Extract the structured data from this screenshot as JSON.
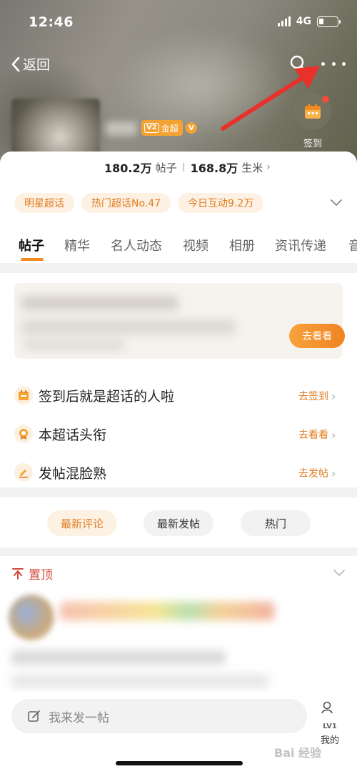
{
  "status_bar": {
    "time": "12:46",
    "network": "4G"
  },
  "nav": {
    "back_label": "返回"
  },
  "profile": {
    "badge_label": "金超",
    "badge_level": "V2",
    "v_mark": "V"
  },
  "checkin": {
    "label": "签到"
  },
  "stats": {
    "posts_count": "180.2万",
    "posts_label": "帖子",
    "fans_count": "168.8万",
    "fans_label": "生米"
  },
  "tags": [
    "明星超话",
    "热门超话No.47",
    "今日互动9.2万"
  ],
  "tabs": [
    "帖子",
    "精华",
    "名人动态",
    "视频",
    "相册",
    "资讯传递",
    "音"
  ],
  "banner": {
    "button": "去看看"
  },
  "tasks": [
    {
      "label": "签到后就是超话的人啦",
      "action": "去签到"
    },
    {
      "label": "本超话头衔",
      "action": "去看看"
    },
    {
      "label": "发帖混脸熟",
      "action": "去发帖"
    }
  ],
  "sort_options": [
    "最新评论",
    "最新发帖",
    "热门"
  ],
  "pinned": {
    "label": "置顶"
  },
  "compose": {
    "placeholder": "我来发一帖"
  },
  "mine": {
    "level": "LV1",
    "label": "我的"
  },
  "watermark": "Bai 经验",
  "colors": {
    "accent": "#f08a22",
    "pin_red": "#d24a3a",
    "arrow_red": "#e8312a"
  }
}
